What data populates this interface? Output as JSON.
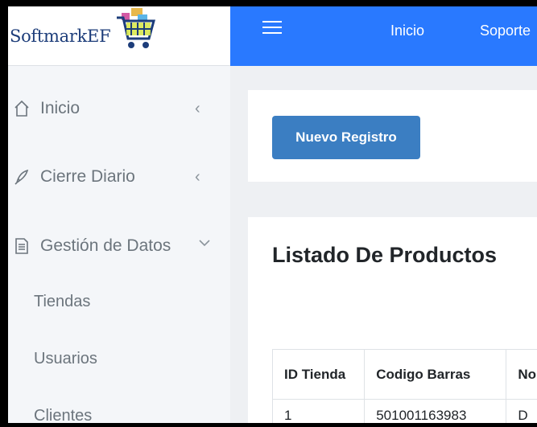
{
  "brand": {
    "name": "SoftmarkEF",
    "logo": "shopping-cart-logo"
  },
  "sidebar": {
    "menu": [
      {
        "label": "Inicio",
        "icon": "home-icon",
        "chevron": "‹"
      },
      {
        "label": "Cierre Diario",
        "icon": "rocket-icon",
        "chevron": "‹"
      },
      {
        "label": "Gestión de Datos",
        "icon": "document-icon",
        "chevron": "⌄"
      }
    ],
    "submenu": [
      "Tiendas",
      "Usuarios",
      "Clientes"
    ]
  },
  "topbar": {
    "menu_icon": "hamburger-icon",
    "links": [
      "Inicio",
      "Soporte"
    ]
  },
  "actions": {
    "new_label": "Nuevo Registro"
  },
  "listing": {
    "title": "Listado De Productos",
    "columns": [
      "ID Tienda",
      "Codigo Barras",
      "No"
    ],
    "rows": [
      [
        "1",
        "501001163983",
        "D"
      ]
    ]
  },
  "colors": {
    "topbar": "#2979ff",
    "button": "#3b7ec2",
    "brand_text": "#1d3d7a"
  }
}
